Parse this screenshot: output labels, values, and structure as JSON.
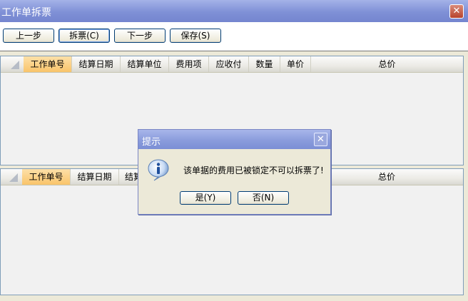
{
  "window": {
    "title": "工作单拆票",
    "close_glyph": "✕"
  },
  "toolbar": {
    "prev": "上一步",
    "split": "拆票(C)",
    "next": "下一步",
    "save": "保存(S)"
  },
  "grid_top": {
    "columns": [
      "工作单号",
      "结算日期",
      "结算单位",
      "费用项",
      "应收付",
      "数量",
      "单价",
      "总价"
    ]
  },
  "grid_bottom": {
    "columns": [
      "工作单号",
      "结算日期",
      "结算",
      "总价"
    ]
  },
  "dialog": {
    "title": "提示",
    "close_glyph": "✕",
    "icon": "info-icon",
    "message": "该单据的费用已被锁定不可以拆票了!",
    "yes": "是(Y)",
    "no": "否(N)"
  },
  "colors": {
    "title_bar": "#7f90d6",
    "highlight_header": "#f9c46a"
  }
}
